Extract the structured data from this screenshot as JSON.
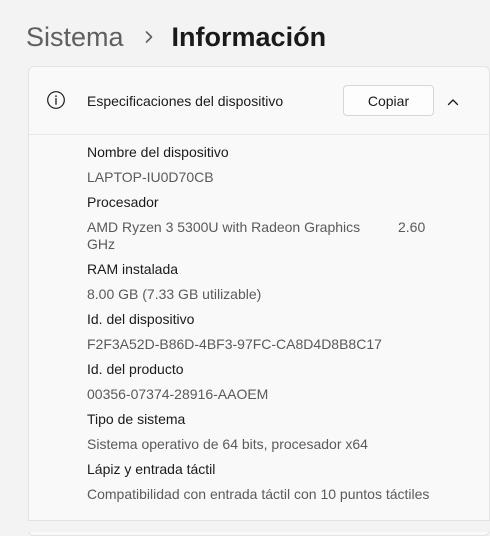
{
  "breadcrumb": {
    "parent": "Sistema",
    "current": "Información"
  },
  "device_specs": {
    "title": "Especificaciones del dispositivo",
    "copy_label": "Copiar",
    "items": [
      {
        "label": "Nombre del dispositivo",
        "value": "LAPTOP-IU0D70CB"
      },
      {
        "label": "Procesador",
        "value_line1": "AMD Ryzen 3 5300U with Radeon Graphics",
        "value_line2": "GHz",
        "value_speed": "2.60"
      },
      {
        "label": "RAM instalada",
        "value": "8.00 GB (7.33 GB utilizable)"
      },
      {
        "label": "Id. del dispositivo",
        "value": "F2F3A52D-B86D-4BF3-97FC-CA8D4D8B8C17"
      },
      {
        "label": "Id. del producto",
        "value": "00356-07374-28916-AAOEM"
      },
      {
        "label": "Tipo de sistema",
        "value": "Sistema operativo de 64 bits, procesador x64"
      },
      {
        "label": "Lápiz y entrada táctil",
        "value": "Compatibilidad con entrada táctil con 10 puntos táctiles"
      }
    ]
  },
  "icons": {
    "breadcrumb_separator": "chevron-right-icon",
    "section": "info-icon",
    "collapse": "chevron-up-icon"
  }
}
